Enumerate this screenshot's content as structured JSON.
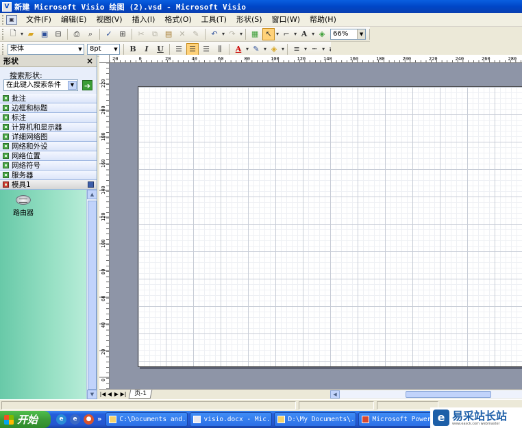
{
  "window": {
    "title": "新建 Microsoft Visio 绘图 (2).vsd - Microsoft Visio"
  },
  "menu": {
    "items": [
      "文件(F)",
      "编辑(E)",
      "视图(V)",
      "插入(I)",
      "格式(O)",
      "工具(T)",
      "形状(S)",
      "窗口(W)",
      "帮助(H)"
    ]
  },
  "toolbar": {
    "zoom_value": "66%",
    "font_name": "宋体",
    "font_size": "8pt",
    "text_tool": "A"
  },
  "shapes_panel": {
    "title": "形状",
    "close_label": "×",
    "search_label": "搜索形状:",
    "search_placeholder": "在此键入搜索条件",
    "go_label": "➔",
    "stencils": [
      "批注",
      "边框和标题",
      "标注",
      "计算机和显示器",
      "详细网络图",
      "网络和外设",
      "网络位置",
      "网络符号",
      "服务器"
    ],
    "open_stencil": "模具1",
    "shapes": [
      {
        "label": "路由器",
        "icon": "router-icon"
      }
    ]
  },
  "rulers": {
    "horizontal_ticks": [
      "20",
      "0",
      "20",
      "40",
      "60",
      "80",
      "100",
      "120",
      "140",
      "160",
      "180",
      "200",
      "220",
      "240",
      "260",
      "280"
    ],
    "vertical_ticks": [
      "220",
      "200",
      "180",
      "160",
      "140",
      "120",
      "100",
      "80",
      "60",
      "40",
      "20",
      "0"
    ]
  },
  "drawing": {
    "page_tab": "页-1"
  },
  "taskbar": {
    "start_label": "开始",
    "more_label": "»",
    "tasks": [
      {
        "label": "C:\\Documents and...",
        "kind": "folder"
      },
      {
        "label": "visio.docx - Mic...",
        "kind": "word"
      },
      {
        "label": "D:\\My Documents\\...",
        "kind": "folder"
      },
      {
        "label": "Microsoft PowerP",
        "kind": "ppt"
      }
    ]
  },
  "watermark": {
    "text": "易采站长站",
    "subtext": "www.easck.com webmaster"
  }
}
